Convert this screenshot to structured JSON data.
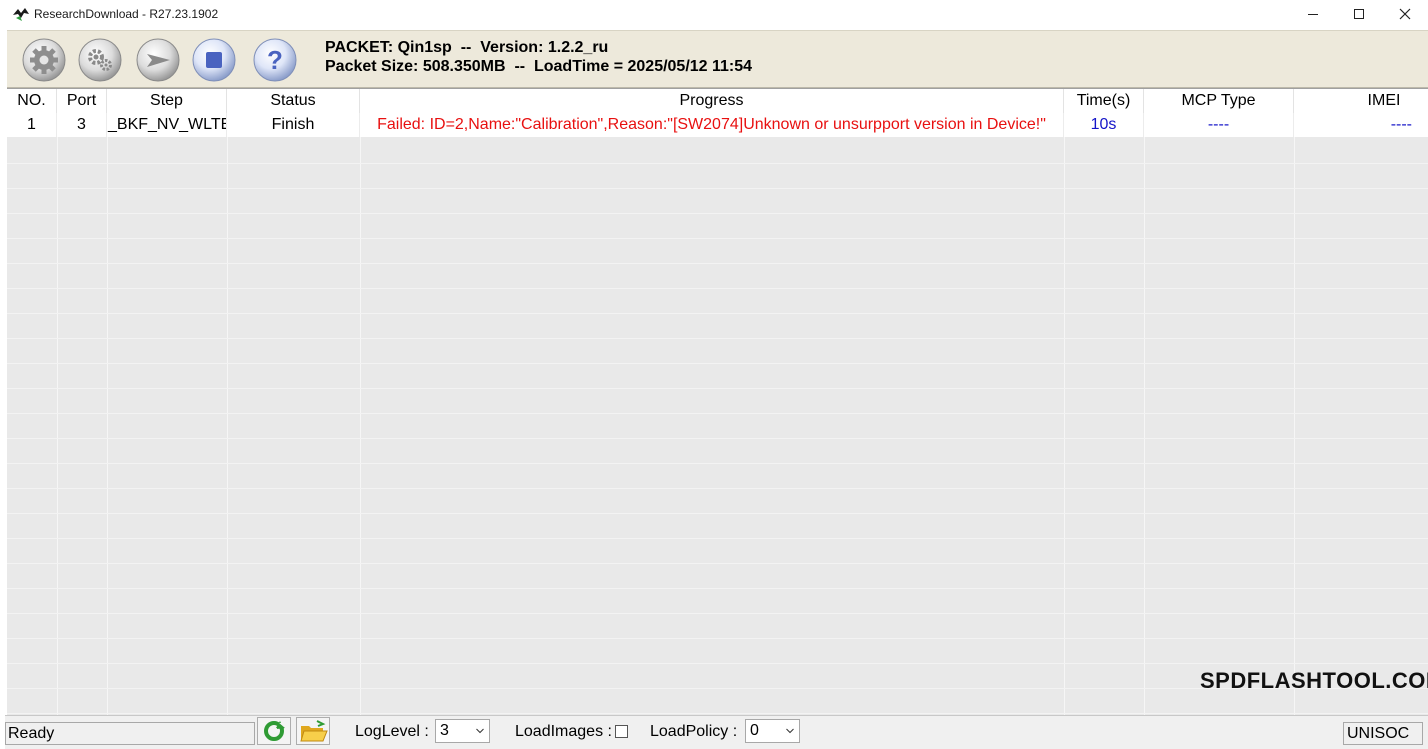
{
  "window": {
    "title": "ResearchDownload - R27.23.1902"
  },
  "toolbar": {
    "packet_line": "PACKET: Qin1sp  --  Version: 1.2.2_ru",
    "size_line": "Packet Size: 508.350MB  --  LoadTime = 2025/05/12 11:54",
    "buttons": [
      "gear-icon",
      "gears-icon",
      "play-arrow-icon",
      "stop-icon",
      "help-icon"
    ]
  },
  "table": {
    "headers": {
      "no": "NO.",
      "port": "Port",
      "step": "Step",
      "status": "Status",
      "progress": "Progress",
      "time": "Time(s)",
      "mcp": "MCP Type",
      "imei": "IMEI"
    },
    "rows": [
      {
        "no": "1",
        "port": "3",
        "step": "_BKF_NV_WLTE",
        "status": "Finish",
        "progress": "Failed: ID=2,Name:\"Calibration\",Reason:\"[SW2074]Unknown or unsurpport version in Device!\"",
        "time": "10s",
        "mcp": "----",
        "imei": "----"
      }
    ]
  },
  "watermark": "SPDFLASHTOOL.COM",
  "statusbar": {
    "status": "Ready",
    "loglevel_label": "LogLevel :",
    "loglevel_value": "3",
    "loadimages_label": "LoadImages :",
    "loadpolicy_label": "LoadPolicy :",
    "loadpolicy_value": "0",
    "chip": "UNISOC"
  },
  "colors": {
    "error_text": "#e81010",
    "info_text": "#1515c8",
    "toolbar_bg": "#ede9db",
    "grid_bg": "#e9e9e9"
  }
}
